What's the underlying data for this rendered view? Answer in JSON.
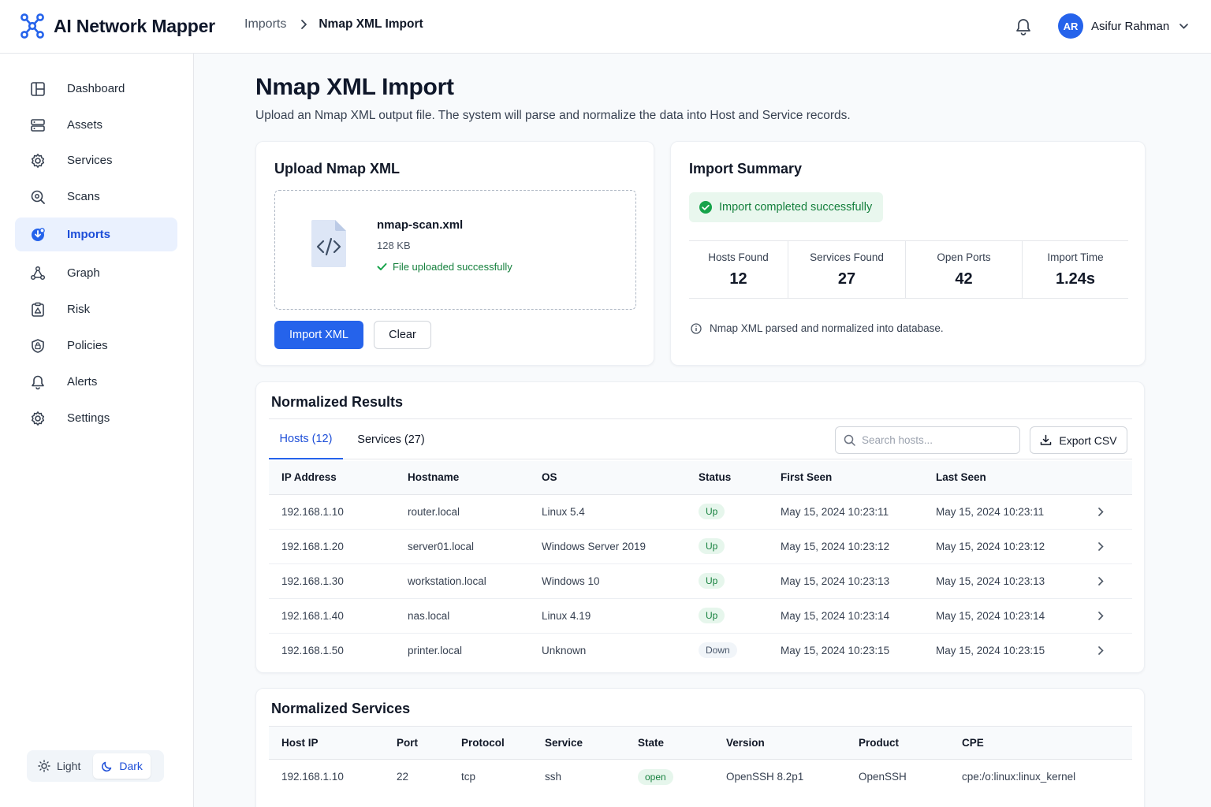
{
  "app": {
    "name": "AI Network Mapper"
  },
  "breadcrumb": {
    "parent": "Imports",
    "current": "Nmap XML Import"
  },
  "user": {
    "initials": "AR",
    "name": "Asifur Rahman"
  },
  "sidebar": {
    "items": [
      {
        "label": "Dashboard",
        "icon": "dashboard-icon"
      },
      {
        "label": "Assets",
        "icon": "server-icon"
      },
      {
        "label": "Services",
        "icon": "gear-icon"
      },
      {
        "label": "Scans",
        "icon": "scan-icon"
      },
      {
        "label": "Imports",
        "icon": "import-icon",
        "active": true
      },
      {
        "label": "Graph",
        "icon": "graph-icon"
      },
      {
        "label": "Risk",
        "icon": "risk-icon"
      },
      {
        "label": "Policies",
        "icon": "policy-icon"
      },
      {
        "label": "Alerts",
        "icon": "bell-icon"
      },
      {
        "label": "Settings",
        "icon": "settings-icon"
      }
    ],
    "theme": {
      "light": "Light",
      "dark": "Dark",
      "selected": "Dark"
    }
  },
  "page": {
    "title": "Nmap XML Import",
    "description": "Upload an Nmap XML output file. The system will parse and normalize the data into Host and Service records."
  },
  "upload": {
    "title": "Upload Nmap XML",
    "file_name": "nmap-scan.xml",
    "file_size": "128 KB",
    "status": "File uploaded successfully",
    "import_button": "Import XML",
    "clear_button": "Clear"
  },
  "summary": {
    "title": "Import Summary",
    "status": "Import completed successfully",
    "stats": [
      {
        "label": "Hosts Found",
        "value": "12"
      },
      {
        "label": "Services Found",
        "value": "27"
      },
      {
        "label": "Open Ports",
        "value": "42"
      },
      {
        "label": "Import Time",
        "value": "1.24s"
      }
    ],
    "note": "Nmap XML parsed and normalized into database."
  },
  "results": {
    "title": "Normalized Results",
    "tabs": [
      "Hosts (12)",
      "Services (27)"
    ],
    "active_tab": 0,
    "search_placeholder": "Search hosts...",
    "export_label": "Export CSV",
    "columns": [
      "IP Address",
      "Hostname",
      "OS",
      "Status",
      "First Seen",
      "Last Seen"
    ],
    "rows": [
      {
        "ip": "192.168.1.10",
        "hostname": "router.local",
        "os": "Linux 5.4",
        "status": "Up",
        "first_seen": "May 15, 2024 10:23:11",
        "last_seen": "May 15, 2024 10:23:11"
      },
      {
        "ip": "192.168.1.20",
        "hostname": "server01.local",
        "os": "Windows Server 2019",
        "status": "Up",
        "first_seen": "May 15, 2024 10:23:12",
        "last_seen": "May 15, 2024 10:23:12"
      },
      {
        "ip": "192.168.1.30",
        "hostname": "workstation.local",
        "os": "Windows 10",
        "status": "Up",
        "first_seen": "May 15, 2024 10:23:13",
        "last_seen": "May 15, 2024 10:23:13"
      },
      {
        "ip": "192.168.1.40",
        "hostname": "nas.local",
        "os": "Linux 4.19",
        "status": "Up",
        "first_seen": "May 15, 2024 10:23:14",
        "last_seen": "May 15, 2024 10:23:14"
      },
      {
        "ip": "192.168.1.50",
        "hostname": "printer.local",
        "os": "Unknown",
        "status": "Down",
        "first_seen": "May 15, 2024 10:23:15",
        "last_seen": "May 15, 2024 10:23:15"
      }
    ]
  },
  "services": {
    "title": "Normalized Services",
    "columns": [
      "Host IP",
      "Port",
      "Protocol",
      "Service",
      "State",
      "Version",
      "Product",
      "CPE"
    ],
    "rows": [
      {
        "host_ip": "192.168.1.10",
        "port": "22",
        "protocol": "tcp",
        "service": "ssh",
        "state": "open",
        "version": "OpenSSH 8.2p1",
        "product": "OpenSSH",
        "cpe": "cpe:/o:linux:linux_kernel"
      }
    ]
  },
  "colors": {
    "accent": "#2563eb",
    "success": "#15803d",
    "active_nav_bg": "#eaf1fe"
  }
}
